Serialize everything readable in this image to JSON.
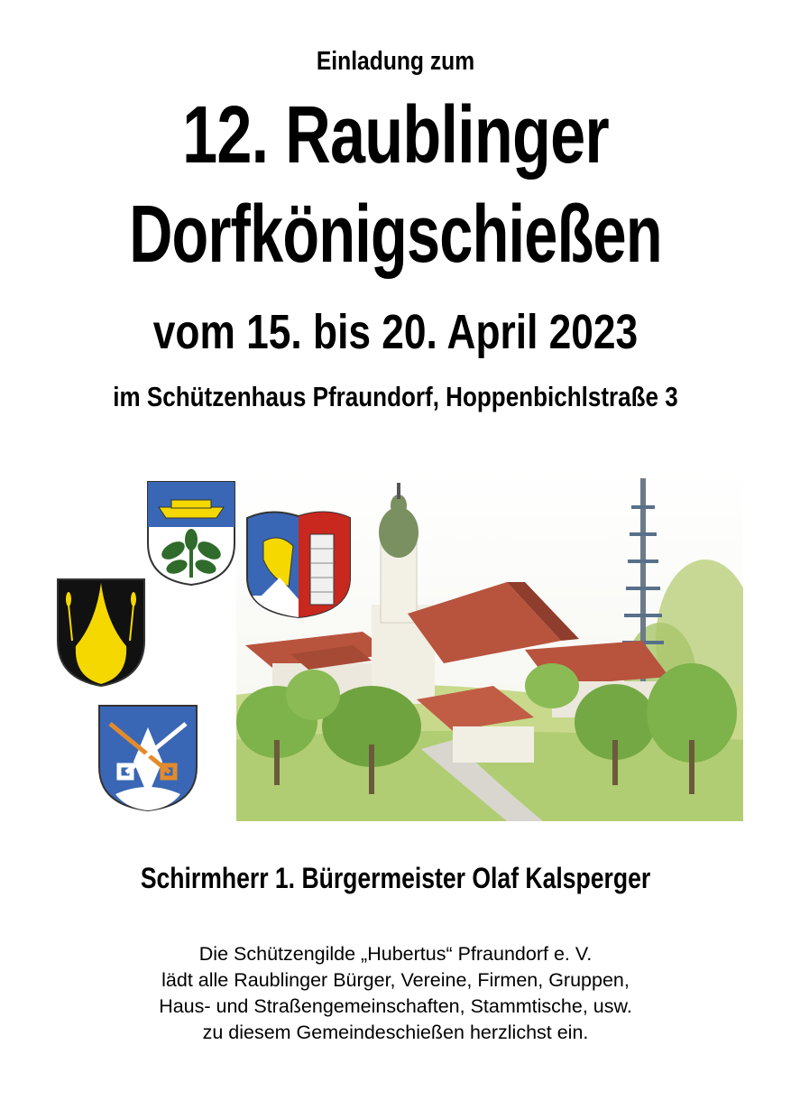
{
  "header": {
    "intro": "Einladung zum",
    "title_line1": "12. Raublinger",
    "title_line2": "Dorfkönigschießen",
    "dates": "vom 15. bis 20. April 2023",
    "venue": "im Schützenhaus Pfraundorf, Hoppenbichlstraße 3"
  },
  "patron": "Schirmherr 1. Bürgermeister Olaf Kalsperger",
  "body": {
    "lines": [
      "Die Schützengilde „Hubertus“ Pfraundorf e. V.",
      "lädt alle Raublinger Bürger, Vereine, Firmen, Gruppen,",
      "Haus- und Straßengemeinschaften, Stammtische, usw.",
      "zu diesem Gemeindeschießen herzlichst ein."
    ]
  },
  "colors": {
    "crest_blue": "#3a67b5",
    "crest_yellow": "#f4d800",
    "crest_green": "#2f6b2a",
    "crest_red": "#c8281e",
    "roof_red": "#b8533e",
    "tree_green": "#7eb24a"
  },
  "icons": [
    "coat-of-arms-boat-oak-icon",
    "coat-of-arms-eagle-tower-icon",
    "coat-of-arms-black-yellow-moon-icon",
    "coat-of-arms-keys-icon",
    "village-church-painting"
  ]
}
